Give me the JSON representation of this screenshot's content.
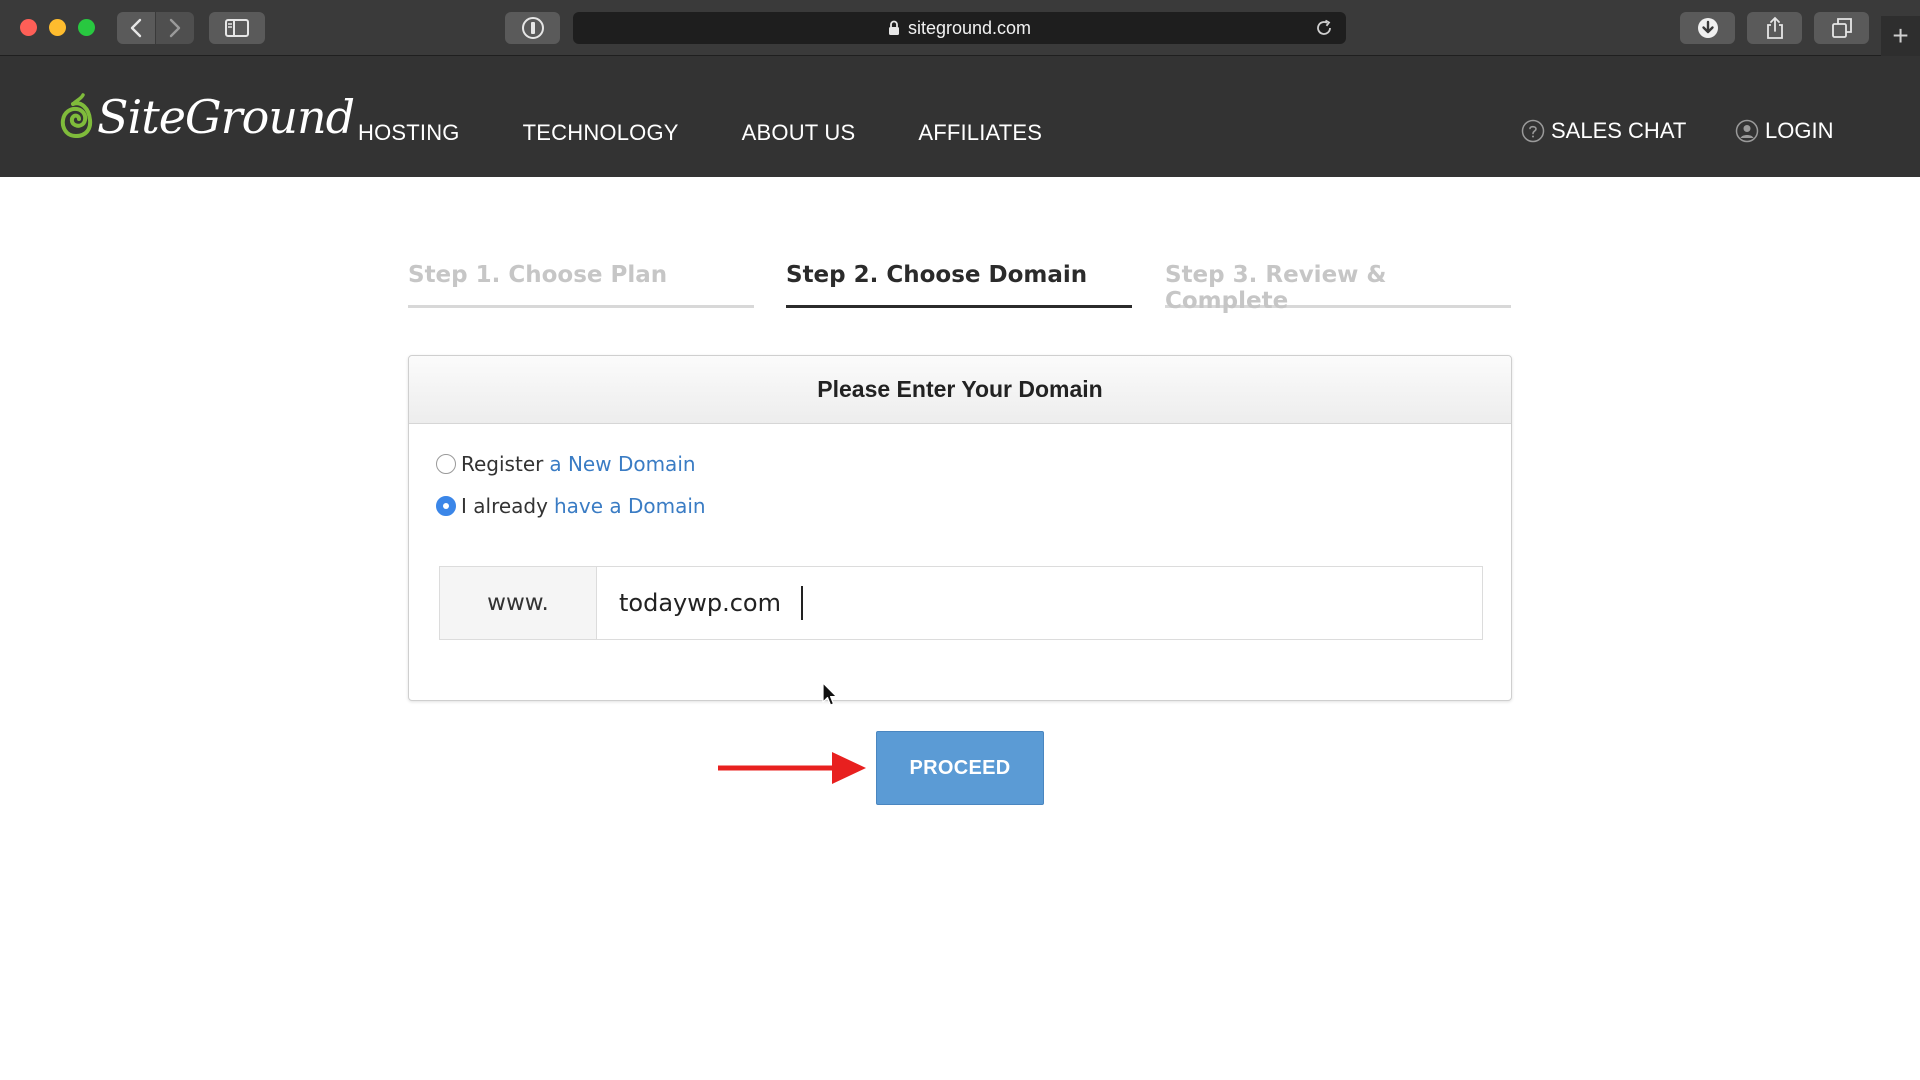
{
  "browser": {
    "url": "siteground.com",
    "icons": [
      "back-icon",
      "forward-icon",
      "sidebar-icon",
      "password-icon",
      "lock-icon",
      "reload-icon",
      "download-icon",
      "share-icon",
      "tabs-icon",
      "new-tab-icon"
    ]
  },
  "site": {
    "logo_text": "SiteGround",
    "nav": [
      "HOSTING",
      "TECHNOLOGY",
      "ABOUT US",
      "AFFILIATES"
    ],
    "sales_chat": "SALES CHAT",
    "login": "LOGIN"
  },
  "steps": [
    {
      "label": "Step 1. Choose Plan",
      "state": "inactive"
    },
    {
      "label": "Step 2. Choose Domain",
      "state": "active"
    },
    {
      "label": "Step 3. Review & Complete",
      "state": "inactive"
    }
  ],
  "panel": {
    "title": "Please Enter Your Domain",
    "option1_prefix": "Register",
    "option1_link": "a New Domain",
    "option2_prefix": "I already",
    "option2_link": "have a Domain",
    "selected_option": "have a Domain",
    "www_prefix": "www.",
    "domain_value": "todaywp.com"
  },
  "proceed_label": "PROCEED",
  "colors": {
    "header_bg": "#333333",
    "logo_green": "#7fbb3b",
    "link_blue": "#3a7cc4",
    "proceed_bg": "#5b9bd5",
    "arrow_red": "#e8201f"
  }
}
